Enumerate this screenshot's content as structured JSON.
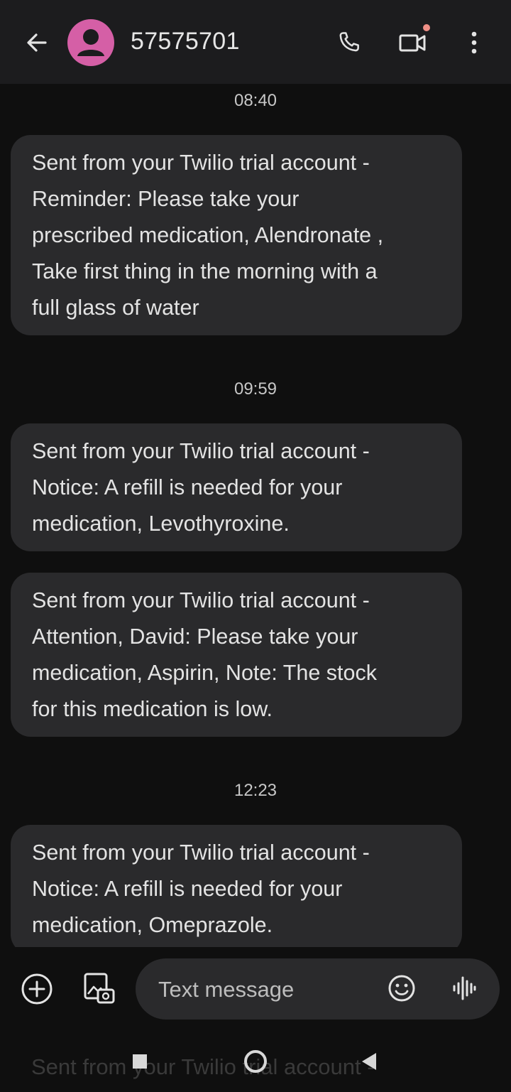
{
  "header": {
    "contact_name": "57575701",
    "icons": [
      "back-arrow-icon",
      "avatar-person-icon",
      "phone-icon",
      "video-camera-icon",
      "more-vert-icon"
    ],
    "avatar_color": "#d55fa6"
  },
  "conversation": {
    "timestamps": [
      "08:40",
      "09:59",
      "12:23"
    ],
    "messages": [
      {
        "text": "Sent from your Twilio trial account -\nReminder: Please take your\nprescribed medication, Alendronate  ,\nTake first thing in the morning with a\nfull glass of water"
      },
      {
        "text": "Sent from your Twilio trial account -\nNotice: A refill is needed for your\nmedication, Levothyroxine."
      },
      {
        "text": "Sent from your Twilio trial account -\nAttention, David: Please take your\nmedication, Aspirin,  Note: The stock\nfor this medication is low."
      },
      {
        "text": "Sent from your Twilio trial account -\nNotice: A refill is needed for your\nmedication, Omeprazole."
      }
    ],
    "ghost_preview": "Sent from your Twilio trial account -"
  },
  "composer": {
    "placeholder": "Text message",
    "icons": [
      "add-circle-icon",
      "gallery-icon",
      "emoji-icon",
      "voice-waveform-icon"
    ]
  },
  "colors": {
    "background": "#0f0f0f",
    "topbar": "#1c1c1e",
    "bubble": "#2a2a2c",
    "text": "#e3e3e3",
    "notification_dot": "#ef8f86"
  }
}
